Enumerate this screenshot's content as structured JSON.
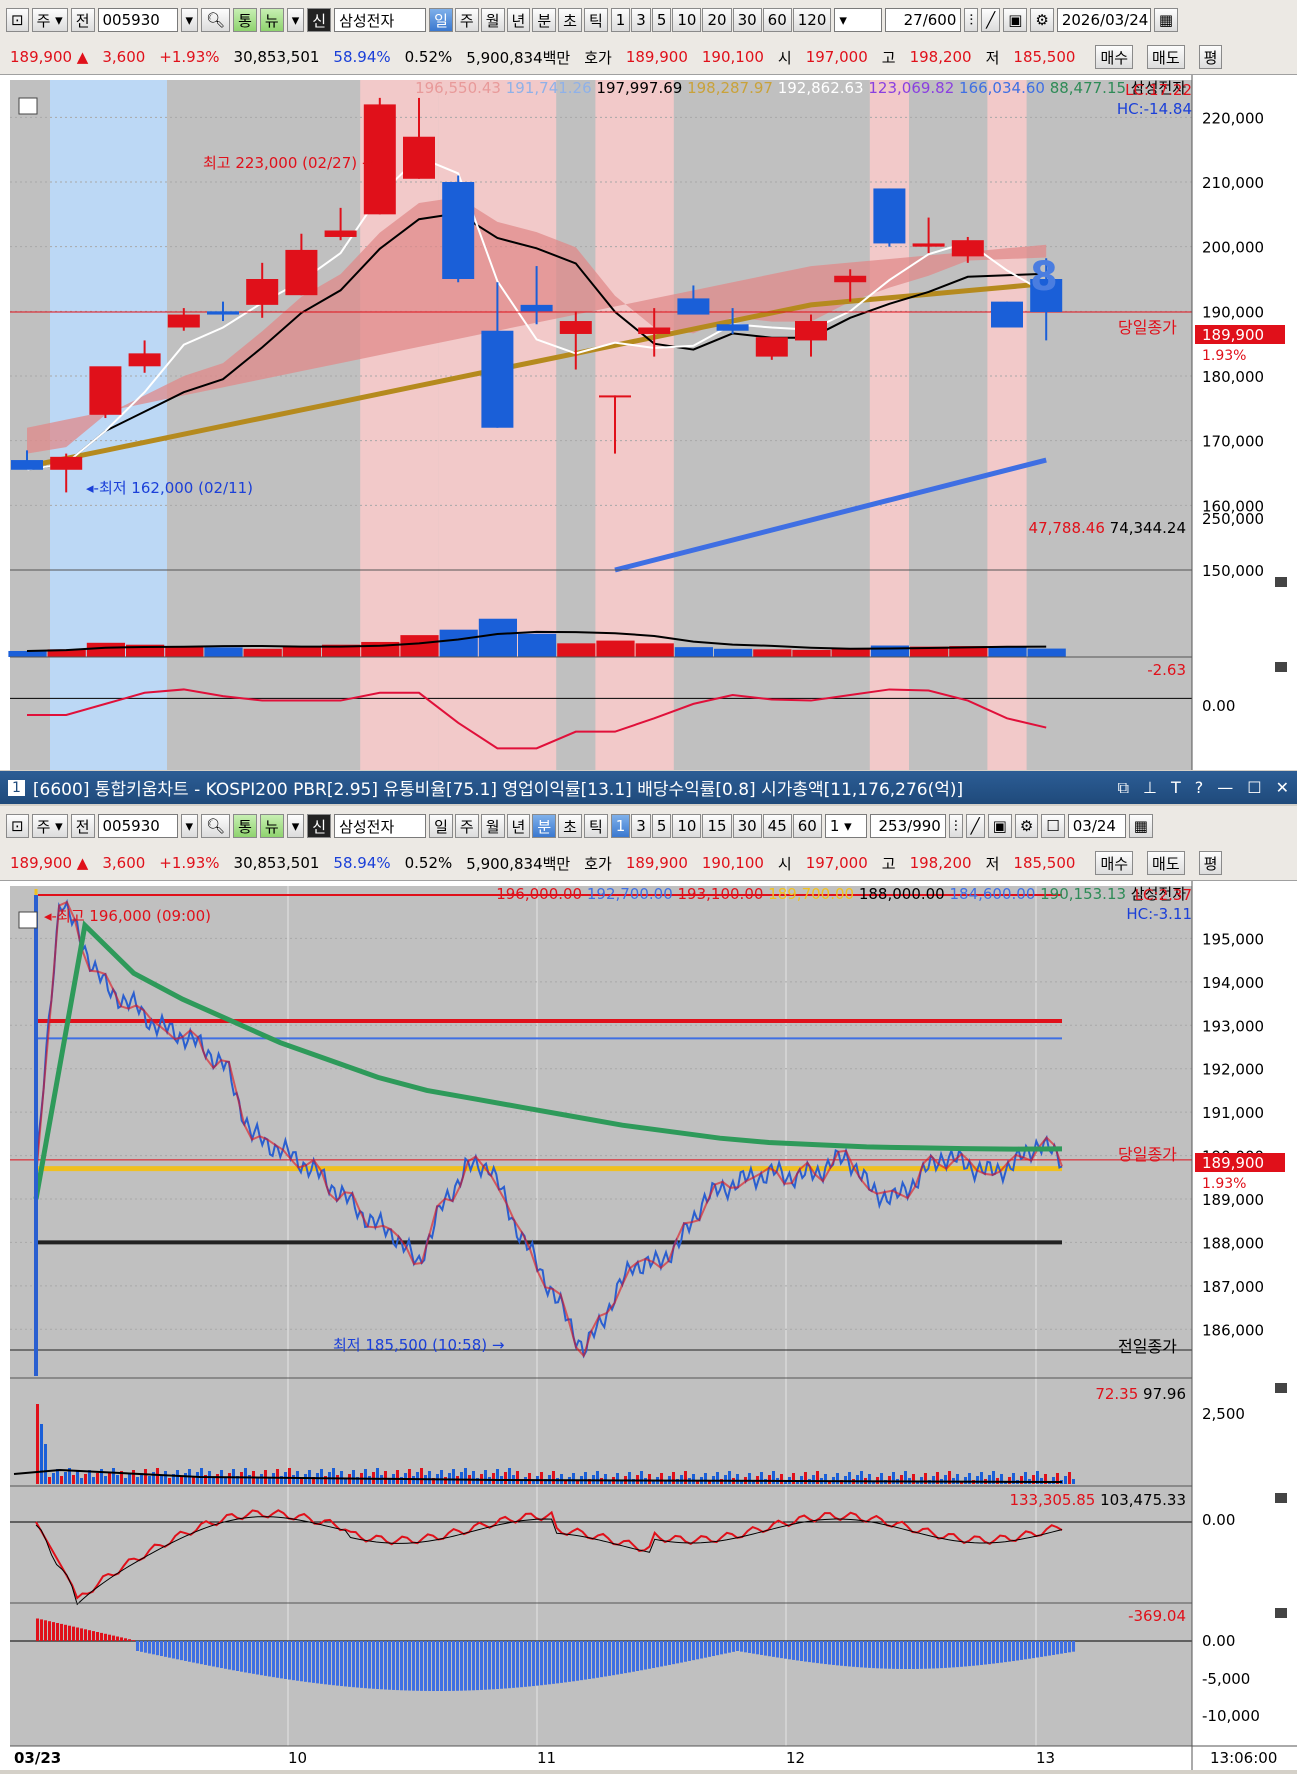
{
  "top": {
    "toolbar": {
      "type": "주",
      "prev": "전",
      "code": "005930",
      "tong": "통",
      "new": "뉴",
      "sin": "신",
      "name": "삼성전자",
      "periods": [
        "일",
        "주",
        "월",
        "년",
        "분",
        "초",
        "틱"
      ],
      "active_period": "일",
      "nums": [
        "1",
        "3",
        "5",
        "10",
        "20",
        "30",
        "60",
        "120"
      ],
      "count": "27",
      "total": "600",
      "date": "2026/03/24"
    },
    "quote": {
      "price": "189,900",
      "change": "3,600",
      "pct": "+1.93%",
      "volume": "30,853,501",
      "ratio": "58.94%",
      "turnover": "0.52%",
      "amount": "5,900,834백만",
      "ask_label": "호가",
      "bid": "189,900",
      "ask": "190,100",
      "open_label": "시",
      "open": "197,000",
      "high_label": "고",
      "high": "198,200",
      "low_label": "저",
      "low": "185,500",
      "buy": "매수",
      "sell": "매도",
      "flat": "평"
    },
    "legend": [
      "196,550.43",
      "191,741.26",
      "197,997.69",
      "198,287.97",
      "192,862.63",
      "123,069.82",
      "166,034.60",
      "88,477.15",
      "삼성전자"
    ],
    "lc": "LC:17.22",
    "hc": "HC:-14.84",
    "high_note": "최고 223,000 (02/27) →",
    "low_note": "◂-최저 162,000 (02/11)",
    "close_label": "당일종가",
    "close_value": "189,900",
    "close_pct": "1.93%",
    "badge": "8",
    "yticks": [
      "220,000",
      "210,000",
      "200,000",
      "190,000",
      "180,000",
      "170,000",
      "160,000",
      "150,000"
    ],
    "vol_legend": [
      "47,788.46",
      "74,344.24"
    ],
    "vol_tick": "250,000",
    "ind_legend": "-2.63",
    "ind_tick": "0.00"
  },
  "title": "[6600] 통합키움차트 - KOSPI200 PBR[2.95] 유통비율[75.1] 영업이익률[13.1] 배당수익률[0.8] 시가총액[11,176,276(억)]",
  "bottom": {
    "toolbar": {
      "periods": [
        "일",
        "주",
        "월",
        "년",
        "분",
        "초",
        "틱"
      ],
      "active_period": "분",
      "nums": [
        "1",
        "3",
        "5",
        "10",
        "15",
        "30",
        "45",
        "60"
      ],
      "active_num": "1",
      "sel": "1",
      "count": "253",
      "total": "990",
      "date": "03/24"
    },
    "legend": [
      "196,000.00",
      "192,700.00",
      "193,100.00",
      "189,700.00",
      "188,000.00",
      "184,600.00",
      "190,153.13",
      "삼성전자"
    ],
    "lc": "LC:2.37",
    "hc": "HC:-3.11",
    "high_note": "◂-최고 196,000 (09:00)",
    "low_note": "최저 185,500 (10:58) →",
    "close_label": "당일종가",
    "close_value": "189,900",
    "close_pct": "1.93%",
    "prev_close_label": "전일종가",
    "yticks": [
      "195,000",
      "194,000",
      "193,000",
      "192,000",
      "191,000",
      "190,000",
      "189,000",
      "188,000",
      "187,000",
      "186,000"
    ],
    "vol_legend": [
      "72.35",
      "97.96"
    ],
    "vol_tick": "2,500",
    "ind1_legend": [
      "133,305.85",
      "103,475.33"
    ],
    "ind1_tick": "0.00",
    "ind2_legend": "-369.04",
    "ind2_ticks": [
      "0.00",
      "-5,000",
      "-10,000"
    ],
    "xlabels": [
      "03/23",
      "10",
      "11",
      "12",
      "13"
    ],
    "time": "13:06:00"
  },
  "chart_data": [
    {
      "type": "candlestick",
      "title": "삼성전자 일봉",
      "ylim": [
        150000,
        225000
      ],
      "candles": [
        {
          "o": 167000,
          "h": 168500,
          "l": 166000,
          "c": 165500
        },
        {
          "o": 165500,
          "h": 168000,
          "l": 162000,
          "c": 167500
        },
        {
          "o": 174000,
          "h": 178000,
          "l": 173500,
          "c": 181500
        },
        {
          "o": 181500,
          "h": 185500,
          "l": 180500,
          "c": 183500
        },
        {
          "o": 187500,
          "h": 190500,
          "l": 187000,
          "c": 189500
        },
        {
          "o": 190000,
          "h": 191500,
          "l": 188500,
          "c": 189500
        },
        {
          "o": 191000,
          "h": 197500,
          "l": 189000,
          "c": 195000
        },
        {
          "o": 192500,
          "h": 202000,
          "l": 192500,
          "c": 199500
        },
        {
          "o": 201500,
          "h": 206000,
          "l": 201000,
          "c": 202500
        },
        {
          "o": 205000,
          "h": 223000,
          "l": 205000,
          "c": 222000
        },
        {
          "o": 210500,
          "h": 223000,
          "l": 210500,
          "c": 217000
        },
        {
          "o": 210000,
          "h": 211000,
          "l": 194500,
          "c": 195000
        },
        {
          "o": 187000,
          "h": 194500,
          "l": 172000,
          "c": 172000
        },
        {
          "o": 191000,
          "h": 197000,
          "l": 188000,
          "c": 190000
        },
        {
          "o": 186500,
          "h": 190000,
          "l": 181000,
          "c": 188500
        },
        {
          "o": 177000,
          "h": 177000,
          "l": 168000,
          "c": 177000
        },
        {
          "o": 186500,
          "h": 190500,
          "l": 183000,
          "c": 187500
        },
        {
          "o": 192000,
          "h": 194000,
          "l": 190000,
          "c": 189500
        },
        {
          "o": 188000,
          "h": 190500,
          "l": 186500,
          "c": 187000
        },
        {
          "o": 183000,
          "h": 185500,
          "l": 182500,
          "c": 186000
        },
        {
          "o": 185500,
          "h": 189500,
          "l": 183000,
          "c": 188500
        },
        {
          "o": 194500,
          "h": 196500,
          "l": 191500,
          "c": 195500
        },
        {
          "o": 209000,
          "h": 209000,
          "l": 200000,
          "c": 200500
        },
        {
          "o": 200000,
          "h": 204500,
          "l": 199000,
          "c": 200500
        },
        {
          "o": 198500,
          "h": 201500,
          "l": 197500,
          "c": 201000
        },
        {
          "o": 191500,
          "h": 191500,
          "l": 187500,
          "c": 187500
        },
        {
          "o": 195000,
          "h": 198200,
          "l": 185500,
          "c": 189900
        }
      ],
      "volume_scale": 300000,
      "volumes": [
        22000,
        28000,
        52000,
        45000,
        40000,
        35000,
        30000,
        40000,
        45000,
        55000,
        80000,
        100000,
        140000,
        85000,
        50000,
        60000,
        50000,
        36000,
        30000,
        28000,
        26000,
        30000,
        42000,
        38000,
        40000,
        38000,
        30853
      ],
      "indicator": [
        -1.5,
        -1.5,
        -0.5,
        0.5,
        0.8,
        0.2,
        -0.2,
        -0.2,
        -0.2,
        0.5,
        0.5,
        -2.2,
        -4.5,
        -4.5,
        -3.0,
        -3.0,
        -1.8,
        -0.5,
        0.3,
        -0.1,
        -0.2,
        0.3,
        0.8,
        0.7,
        -0.2,
        -1.8,
        -2.63
      ],
      "ind_range": [
        -6,
        3
      ]
    },
    {
      "type": "line",
      "title": "삼성전자 1분봉",
      "ylim": [
        185500,
        196000
      ],
      "x": [
        "03/23",
        "10",
        "11",
        "12",
        "13"
      ],
      "price": [
        189500,
        196000,
        194800,
        193800,
        193500,
        193000,
        192800,
        192500,
        192000,
        190500,
        190200,
        189900,
        189500,
        189000,
        188500,
        188200,
        187500,
        188800,
        189700,
        189800,
        188500,
        187500,
        186500,
        185500,
        186500,
        187500,
        187500,
        188000,
        189000,
        189300,
        189500,
        189600,
        189500,
        189700,
        190000,
        189200,
        189000,
        189500,
        190000,
        189800,
        189600,
        189800,
        190300,
        189900
      ],
      "ma_green": [
        189000,
        195300,
        194200,
        193600,
        193100,
        192600,
        192200,
        191800,
        191500,
        191300,
        191100,
        190900,
        190700,
        190550,
        190400,
        190300,
        190250,
        190200,
        190180,
        190160,
        190150,
        190153
      ]
    }
  ]
}
